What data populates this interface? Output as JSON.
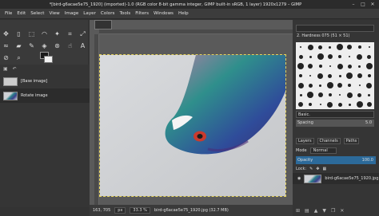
{
  "window": {
    "title": "*[bird-g6acae5e75_1920] (imported)-1.0 (RGB color 8-bit gamma integer, GIMP built-in sRGB, 1 layer) 1920x1279 – GIMP",
    "minimize": "–",
    "maximize": "□",
    "close": "✕"
  },
  "menu": [
    "File",
    "Edit",
    "Select",
    "View",
    "Image",
    "Layer",
    "Colors",
    "Tools",
    "Filters",
    "Windows",
    "Help"
  ],
  "images_panel": {
    "items": [
      {
        "label": "[Base image]"
      },
      {
        "label": "Rotate image"
      }
    ]
  },
  "statusbar": {
    "coords": "163, 705",
    "unit": "px",
    "zoom": "33.3 %",
    "file_info": "bird-g6acae5e75_1920.jpg (32.7 MB)"
  },
  "brushes": {
    "current_brush": "2. Hardness 075 (51 × 51)",
    "preset": "Basic.",
    "spacing_label": "Spacing",
    "spacing_value": "5.0"
  },
  "layers_panel": {
    "tabs": [
      "Layers",
      "Channels",
      "Paths"
    ],
    "mode_label": "Mode",
    "mode_value": "Normal",
    "opacity_label": "Opacity",
    "opacity_value": "100.0",
    "lock_label": "Lock:",
    "layer_name": "bird-g6acae5e75_1920.jpg"
  },
  "colors": {
    "accent": "#2c6a9a",
    "foreground": "#1a1a1a",
    "background": "#f2f2f2",
    "selection": "#e6d35a"
  }
}
